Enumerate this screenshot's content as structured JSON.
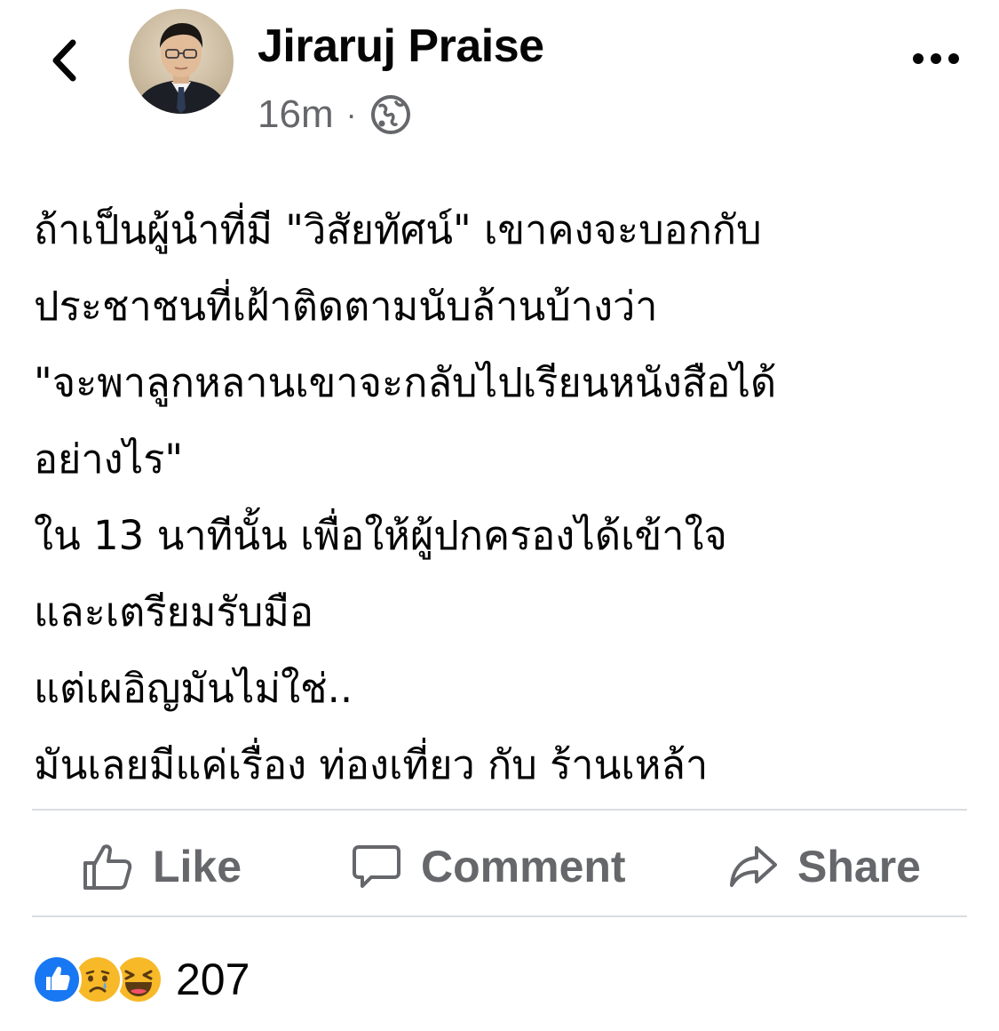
{
  "header": {
    "author_name": "Jiraruj Praise",
    "timestamp": "16m",
    "separator": "·",
    "audience_icon": "globe-icon",
    "back_icon": "chevron-left-icon",
    "more_icon": "more-horizontal-icon"
  },
  "post": {
    "lines": [
      "ถ้าเป็นผู้นำที่มี \"วิสัยทัศน์\" เขาคงจะบอกกับ",
      "ประชาชนที่เฝ้าติดตามนับล้านบ้างว่า",
      "\"จะพาลูกหลานเขาจะกลับไปเรียนหนังสือได้",
      "อย่างไร\"",
      "ใน 13 นาทีนั้น เพื่อให้ผู้ปกครองได้เข้าใจ",
      "และเตรียมรับมือ",
      "แต่เผอิญมันไม่ใช่..",
      "มันเลยมีแค่เรื่อง ท่องเที่ยว กับ ร้านเหล้า"
    ]
  },
  "actions": {
    "like_label": "Like",
    "comment_label": "Comment",
    "share_label": "Share"
  },
  "reactions": {
    "types": [
      "like",
      "sad",
      "haha"
    ],
    "count": "207"
  },
  "colors": {
    "text_primary": "#050505",
    "text_secondary": "#65676b",
    "divider": "#dadde1",
    "like_blue": "#1877f2",
    "emoji_yellow": "#f7b928"
  }
}
